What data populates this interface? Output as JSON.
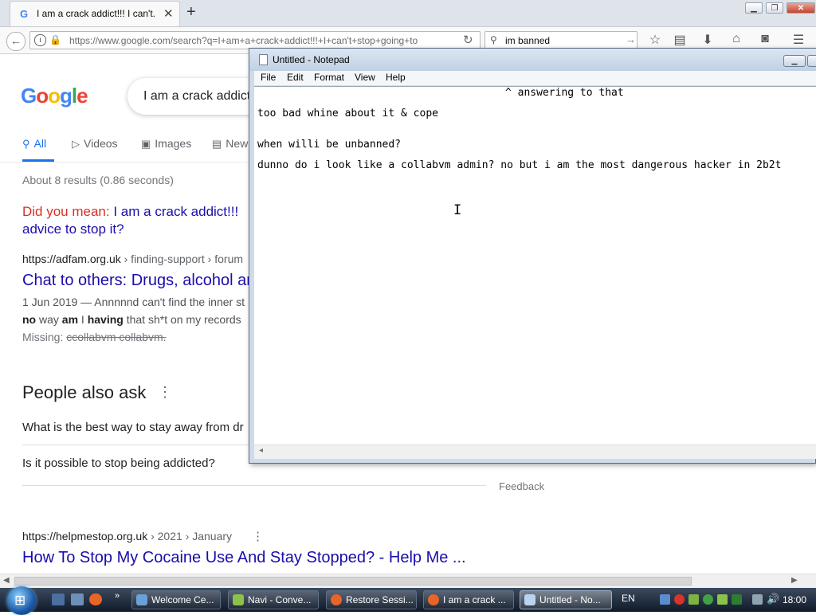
{
  "browser": {
    "tab_title": "I am a crack addict!!! I can't...",
    "tab_favicon": "G",
    "close_tab": "✕",
    "new_tab": "+",
    "window_buttons": {
      "minimize": "▁",
      "maximize": "❐",
      "close": "✕"
    },
    "url": "https://www.google.com/search?q=I+am+a+crack+addict!!!+I+can't+stop+going+to",
    "search_value": "im banned"
  },
  "google": {
    "search_query": "I am a crack addict",
    "tabs": [
      {
        "label": "All",
        "icon": "search-icon"
      },
      {
        "label": "Videos",
        "icon": "play-icon"
      },
      {
        "label": "Images",
        "icon": "image-icon"
      },
      {
        "label": "New",
        "icon": "news-icon"
      }
    ],
    "stats": "About 8 results (0.86 seconds)",
    "did_you_mean_label": "Did you mean:",
    "did_you_mean_link_1": "I am a crack addict!!!",
    "did_you_mean_link_2": "advice to stop it?",
    "result1": {
      "site": "https://adfam.org.uk",
      "crumbs": " › finding-support › forum",
      "title": "Chat to others: Drugs, alcohol ar",
      "snippet1": "1 Jun 2019 — Annnnnd can't find the inner st",
      "snippet2_b1": "no",
      "snippet2_t1": " way ",
      "snippet2_b2": "am",
      "snippet2_t2": " I ",
      "snippet2_b3": "having",
      "snippet2_t3": " that sh*t on my records",
      "missing_label": "Missing:",
      "missing_terms": "ccollabvm collabvm."
    },
    "people_also_ask": "People also ask",
    "paa_questions": [
      "What is the best way to stay away from dr",
      "Is it possible to stop being addicted?"
    ],
    "feedback": "Feedback",
    "result2": {
      "site": "https://helpmestop.org.uk",
      "crumbs": " › 2021 › January",
      "title": "How To Stop My Cocaine Use And Stay Stopped? - Help Me ..."
    }
  },
  "notepad": {
    "title": "Untitled - Notepad",
    "menu": [
      "File",
      "Edit",
      "Format",
      "View",
      "Help"
    ],
    "lines": [
      "^ answering to that",
      "too bad whine about it & cope",
      "when willi be unbanned?",
      "dunno do i look like a collabvm admin? no but i am the most dangerous hacker in 2b2t"
    ],
    "caret": "I"
  },
  "taskbar": {
    "buttons": [
      {
        "label": "Welcome Ce...",
        "color": "#6aa0d8"
      },
      {
        "label": "Navi - Conve...",
        "color": "#8bc34a"
      },
      {
        "label": "Restore Sessi...",
        "color": "#e8652a"
      },
      {
        "label": "I am a crack ...",
        "color": "#e8652a"
      },
      {
        "label": "Untitled - No...",
        "color": "#b8d4f0"
      }
    ],
    "language": "EN",
    "clock": "18:00"
  }
}
